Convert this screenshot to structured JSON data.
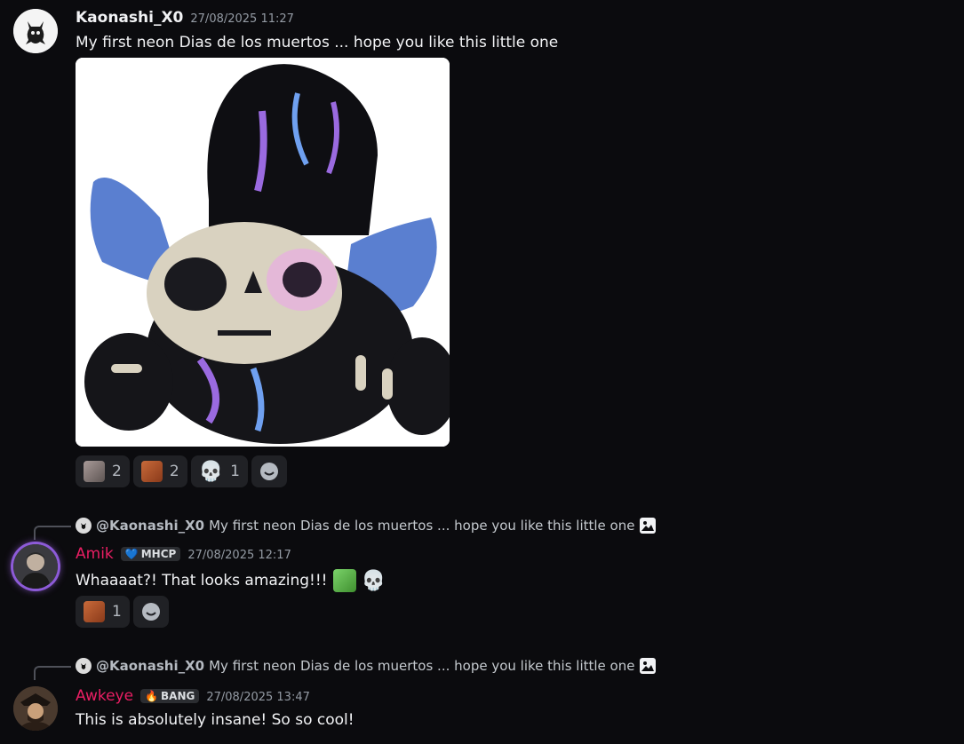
{
  "messages": [
    {
      "author": "Kaonashi_X0",
      "timestamp": "27/08/2025 11:27",
      "text": "My first neon Dias de los muertos ... hope you like this little one",
      "reactions": [
        {
          "emoji": "rat-emoji",
          "count": "2"
        },
        {
          "emoji": "fox-heart-emoji",
          "count": "2"
        },
        {
          "emoji": "skull-emoji",
          "count": "1"
        }
      ]
    },
    {
      "reply_to": {
        "author": "@Kaonashi_X0",
        "text": "My first neon Dias de los muertos ... hope you like this little one"
      },
      "author": "Amik",
      "tag": "MHCP",
      "timestamp": "27/08/2025 12:17",
      "text": "Whaaaat?! That looks amazing!!!",
      "reactions": [
        {
          "emoji": "fox-heart-emoji",
          "count": "1"
        }
      ]
    },
    {
      "reply_to": {
        "author": "@Kaonashi_X0",
        "text": "My first neon Dias de los muertos ... hope you like this little one"
      },
      "author": "Awkeye",
      "tag": "BANG",
      "timestamp": "27/08/2025 13:47",
      "text": "This is absolutely insane! So so cool!"
    }
  ],
  "colors": {
    "background": "#0b0b0e",
    "role_pink": "#e91e63",
    "reaction_bg": "#202125"
  }
}
